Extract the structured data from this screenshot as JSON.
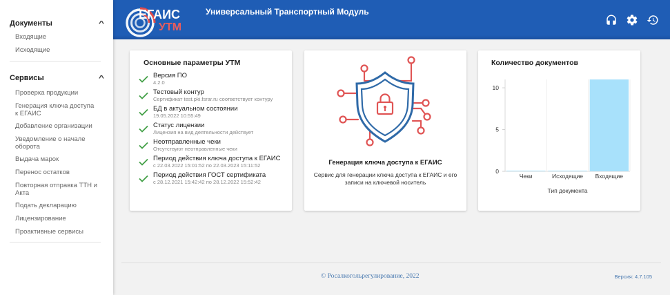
{
  "header": {
    "logo_top": "ЕГАИС",
    "logo_bottom": "УТМ",
    "title": "Универсальный Транспортный Модуль",
    "icons": [
      "headset-icon",
      "gear-icon",
      "history-icon"
    ]
  },
  "sidebar": {
    "sections": [
      {
        "title": "Документы",
        "items": [
          "Входящие",
          "Исходящие"
        ]
      },
      {
        "title": "Сервисы",
        "items": [
          "Проверка продукции",
          "Генерация ключа доступа к ЕГАИС",
          "Добавление организации",
          "Уведомление о начале оборота",
          "Выдача марок",
          "Перенос остатков",
          "Повторная отправка ТТН и Акта",
          "Подать декларацию",
          "Лицензирование",
          "Проактивные сервисы"
        ]
      }
    ]
  },
  "params_card": {
    "title": "Основные параметры УТМ",
    "items": [
      {
        "label": "Версия ПО",
        "value": "4.2.0"
      },
      {
        "label": "Тестовый контур",
        "value": "Сертификат test.pki.fsrar.ru соответствует контуру"
      },
      {
        "label": "БД в актуальном состоянии",
        "value": "19.05.2022 10:55:49"
      },
      {
        "label": "Статус лицензии",
        "value": "Лицензия на вид деятельности действует"
      },
      {
        "label": "Неотправленные чеки",
        "value": "Отсутствуют неотправленные чеки"
      },
      {
        "label": "Период действия ключа доступа к ЕГАИС",
        "value": "с 22.03.2022 15:01:52 по 22.03.2023 15:11:52"
      },
      {
        "label": "Период действия ГОСТ сертификата",
        "value": "с 28.12.2021 15:42:42 по 28.12.2022 15:52:42"
      }
    ]
  },
  "key_card": {
    "title": "Генерация ключа доступа к ЕГАИС",
    "description": "Сервис для генерации ключа доступа к ЕГАИС и его записи на ключевой носитель"
  },
  "chart_card": {
    "title": "Количество документов"
  },
  "chart_data": {
    "type": "bar",
    "title": "Количество документов",
    "categories": [
      "Чеки",
      "Исходящие",
      "Входящие"
    ],
    "values": [
      0,
      0,
      11
    ],
    "xlabel": "Тип документа",
    "ylabel": "",
    "ylim": [
      0,
      11
    ],
    "yticks": [
      0,
      5,
      10
    ],
    "grid": true,
    "bar_color": "#a8e1fb"
  },
  "footer": {
    "copyright": "© Росалкогольрегулирование, 2022",
    "version": "Версия: 4.7.105"
  },
  "colors": {
    "header": "#1f5db5",
    "check": "#43a047",
    "link": "#4a7ab0",
    "shield_blue": "#2f6aa8",
    "shield_red": "#e05555"
  }
}
